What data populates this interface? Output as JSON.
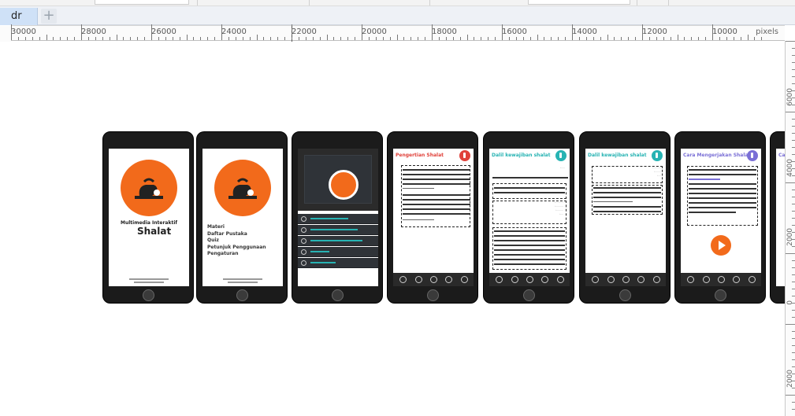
{
  "tab": {
    "doc_label": "dr",
    "add_label": "+"
  },
  "ruler": {
    "labels": [
      "30000",
      "28000",
      "26000",
      "24000",
      "22000",
      "20000",
      "18000",
      "16000",
      "14000",
      "12000",
      "10000"
    ],
    "unit": "pixels"
  },
  "vruler": {
    "labels": [
      "6000",
      "4000",
      "2000",
      "0",
      "2000"
    ]
  },
  "screens": {
    "splash": {
      "title": "Multimedia Interaktif",
      "subtitle": "Shalat"
    },
    "menu": {
      "items": [
        "Materi",
        "Daftar Pustaka",
        "Quiz",
        "Petunjuk Penggunaan",
        "Pengaturan"
      ]
    },
    "pengertian": {
      "title": "Pengertian Shalat",
      "accent": "#e0413a"
    },
    "dalil1": {
      "title": "Dalil kewajiban shalat",
      "accent": "#27b3b3"
    },
    "dalil2": {
      "title": "Dalil kewajiban shalat",
      "accent": "#27b3b3"
    },
    "cara": {
      "title": "Cara Mengerjakan Shalat",
      "accent": "#7a6fd6"
    },
    "partial": {
      "title": "Ca"
    }
  },
  "colors": {
    "orange": "#f26a1b",
    "teal": "#27b3b3",
    "dark": "#2b2b2b"
  }
}
